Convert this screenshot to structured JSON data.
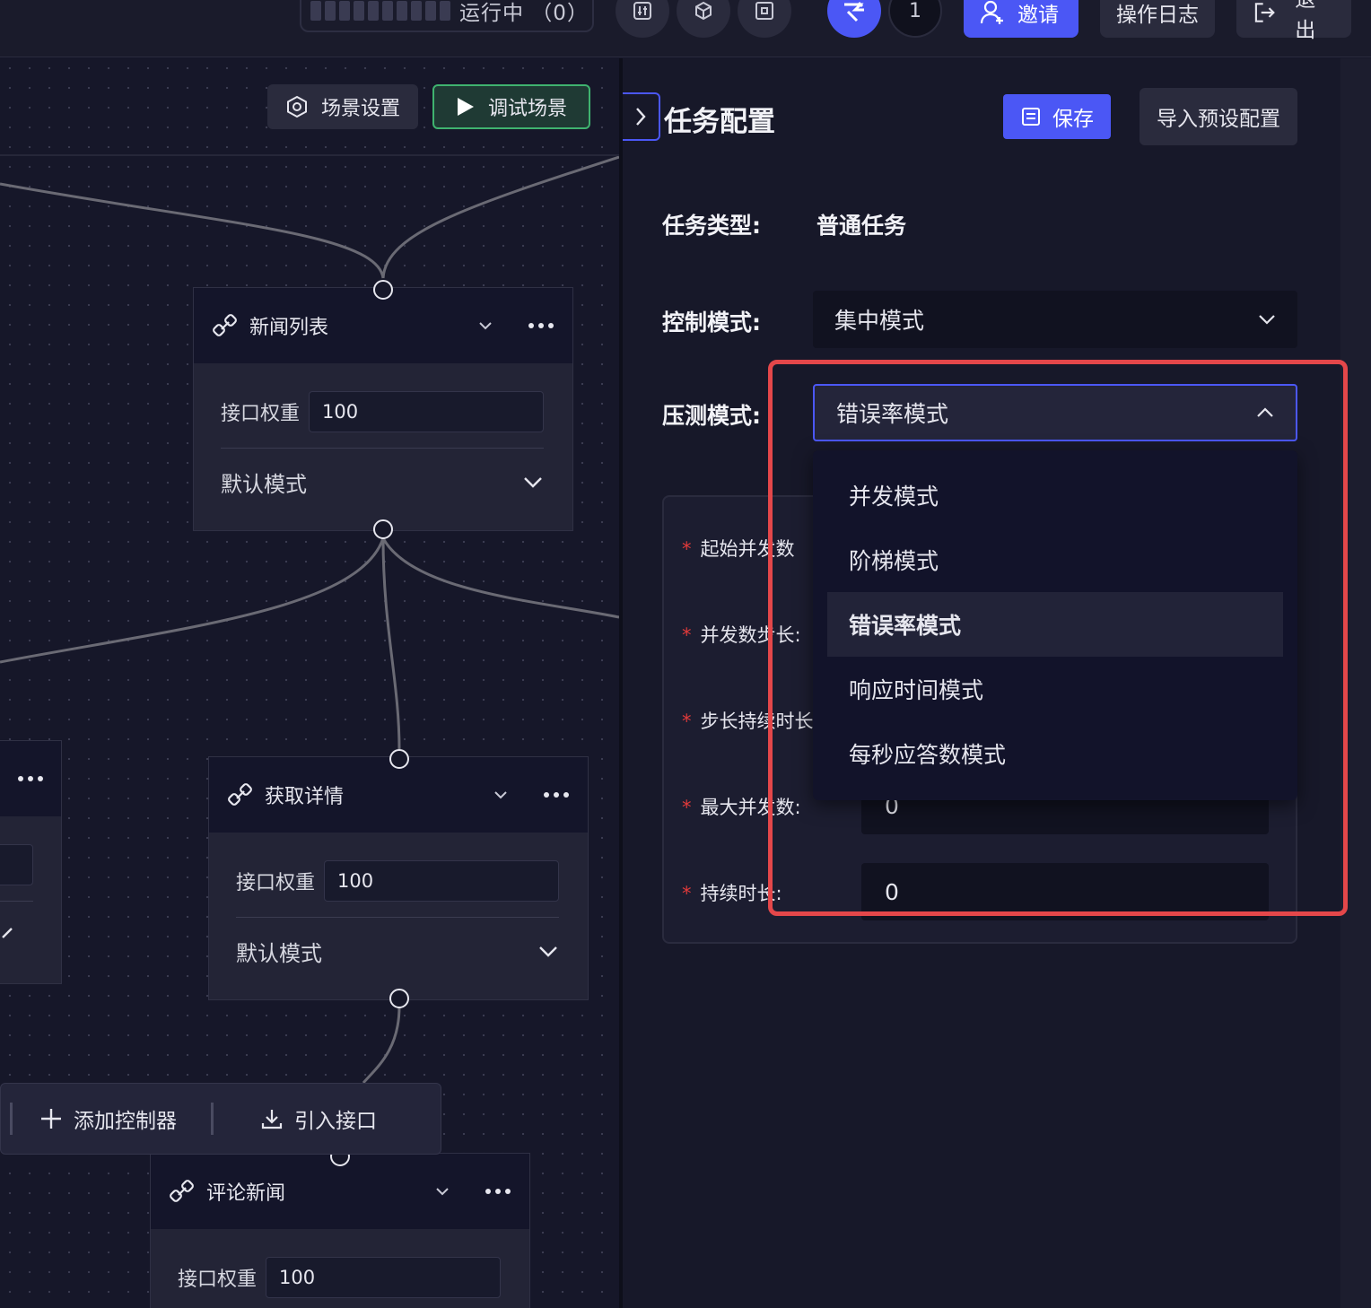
{
  "topbar": {
    "status_label": "运行中 （0）",
    "user_count": "1",
    "invite_label": "邀请",
    "log_label": "操作日志",
    "quit_label": "退出"
  },
  "canvas": {
    "scene_settings_label": "场景设置",
    "debug_scene_label": "调试场景",
    "nodes": [
      {
        "title": "新闻列表",
        "weight_label": "接口权重",
        "weight_value": "100",
        "mode": "默认模式"
      },
      {
        "title": "获取详情",
        "weight_label": "接口权重",
        "weight_value": "100",
        "mode": "默认模式"
      },
      {
        "title": "评论新闻",
        "weight_label": "接口权重",
        "weight_value": "100"
      }
    ],
    "bottom_toolbar": {
      "add_controller_label": "添加控制器",
      "import_api_label": "引入接口"
    }
  },
  "panel": {
    "title": "任务配置",
    "save_label": "保存",
    "import_preset_label": "导入预设配置",
    "task_type_label": "任务类型:",
    "task_type_value": "普通任务",
    "control_mode_label": "控制模式:",
    "control_mode_value": "集中模式",
    "stress_mode_label": "压测模式:",
    "stress_mode_value": "错误率模式",
    "stress_mode_options": [
      "并发模式",
      "阶梯模式",
      "错误率模式",
      "响应时间模式",
      "每秒应答数模式"
    ],
    "fields": [
      {
        "label": "起始并发数",
        "value": ""
      },
      {
        "label": "并发数步长:",
        "value": ""
      },
      {
        "label": "步长持续时长:",
        "value": ""
      },
      {
        "label": "最大并发数:",
        "value": "0"
      },
      {
        "label": "持续时长:",
        "value": "0"
      }
    ]
  },
  "colors": {
    "accent": "#4b57f5",
    "success": "#3fb36f",
    "highlight": "#e4474a",
    "required": "#e03a3a"
  }
}
